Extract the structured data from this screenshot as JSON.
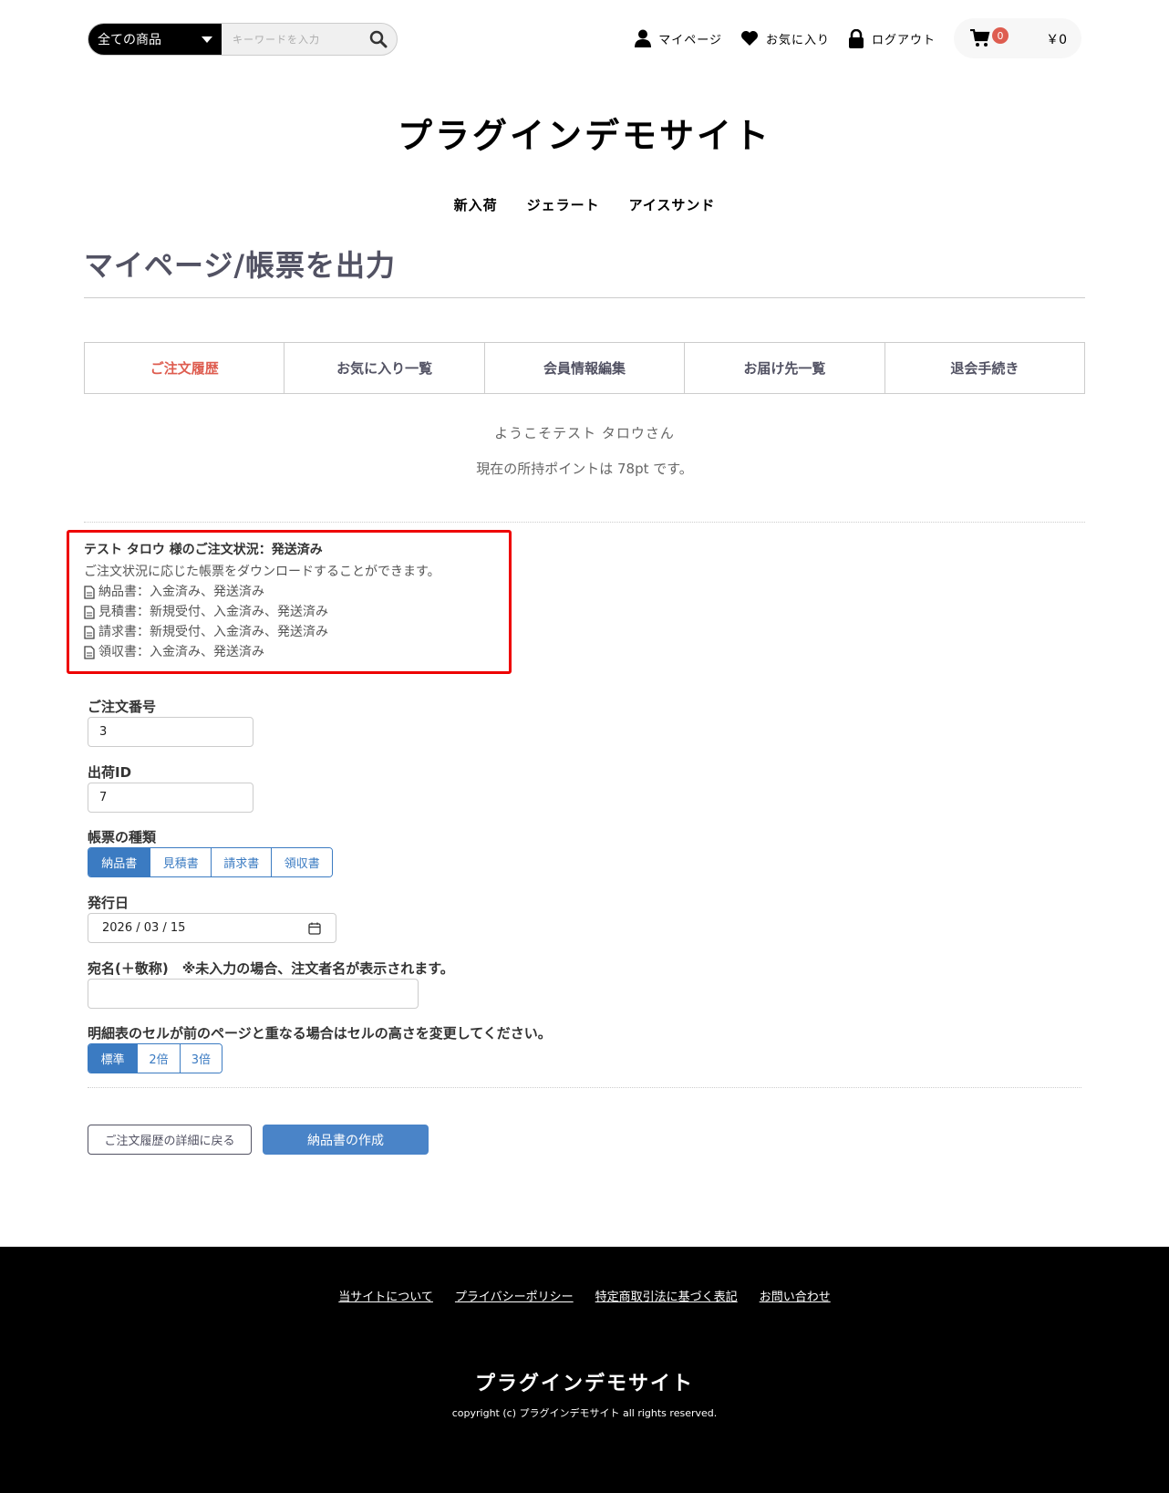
{
  "header": {
    "category_select": "全ての商品",
    "search_placeholder": "キーワードを入力",
    "mypage": "マイページ",
    "favorites": "お気に入り",
    "logout": "ログアウト",
    "cart_count": "0",
    "cart_total": "￥0"
  },
  "site_title": "プラグインデモサイト",
  "category_nav": [
    "新入荷",
    "ジェラート",
    "アイスサンド"
  ],
  "page_heading": "マイページ/帳票を出力",
  "tabs": [
    "ご注文履歴",
    "お気に入り一覧",
    "会員情報編集",
    "お届け先一覧",
    "退会手続き"
  ],
  "welcome": "ようこそテスト タロウさん",
  "points_text": "現在の所持ポイントは 78pt です。",
  "info_box": {
    "title": "テスト タロウ 様のご注文状況：発送済み",
    "description": "ご注文状況に応じた帳票をダウンロードすることができます。",
    "lines": [
      "納品書：入金済み、発送済み",
      "見積書：新規受付、入金済み、発送済み",
      "請求書：新規受付、入金済み、発送済み",
      "領収書：入金済み、発送済み"
    ]
  },
  "form": {
    "order_no_label": "ご注文番号",
    "order_no_value": "3",
    "shipping_id_label": "出荷ID",
    "shipping_id_value": "7",
    "doc_type_label": "帳票の種類",
    "doc_types": [
      "納品書",
      "見積書",
      "請求書",
      "領収書"
    ],
    "doc_type_selected": "納品書",
    "issue_date_label": "発行日",
    "issue_date_value": "2026 / 03 / 15",
    "addressee_label": "宛名(＋敬称)　※未入力の場合、注文者名が表示されます。",
    "addressee_value": "",
    "cell_height_label": "明細表のセルが前のページと重なる場合はセルの高さを変更してください。",
    "cell_heights": [
      "標準",
      "2倍",
      "3倍"
    ],
    "cell_height_selected": "標準"
  },
  "buttons": {
    "back": "ご注文履歴の詳細に戻る",
    "create": "納品書の作成"
  },
  "footer": {
    "links": [
      "当サイトについて",
      "プライバシーポリシー",
      "特定商取引法に基づく表記",
      "お問い合わせ"
    ],
    "title": "プラグインデモサイト",
    "copyright": "copyright (c) プラグインデモサイト all rights reserved."
  },
  "colors": {
    "accent_red": "#de5d50",
    "primary_blue": "#3b7bc2",
    "highlight_border": "#e00000"
  },
  "icons": [
    "search-icon",
    "user-icon",
    "heart-icon",
    "lock-icon",
    "cart-icon",
    "document-icon",
    "calendar-icon"
  ]
}
